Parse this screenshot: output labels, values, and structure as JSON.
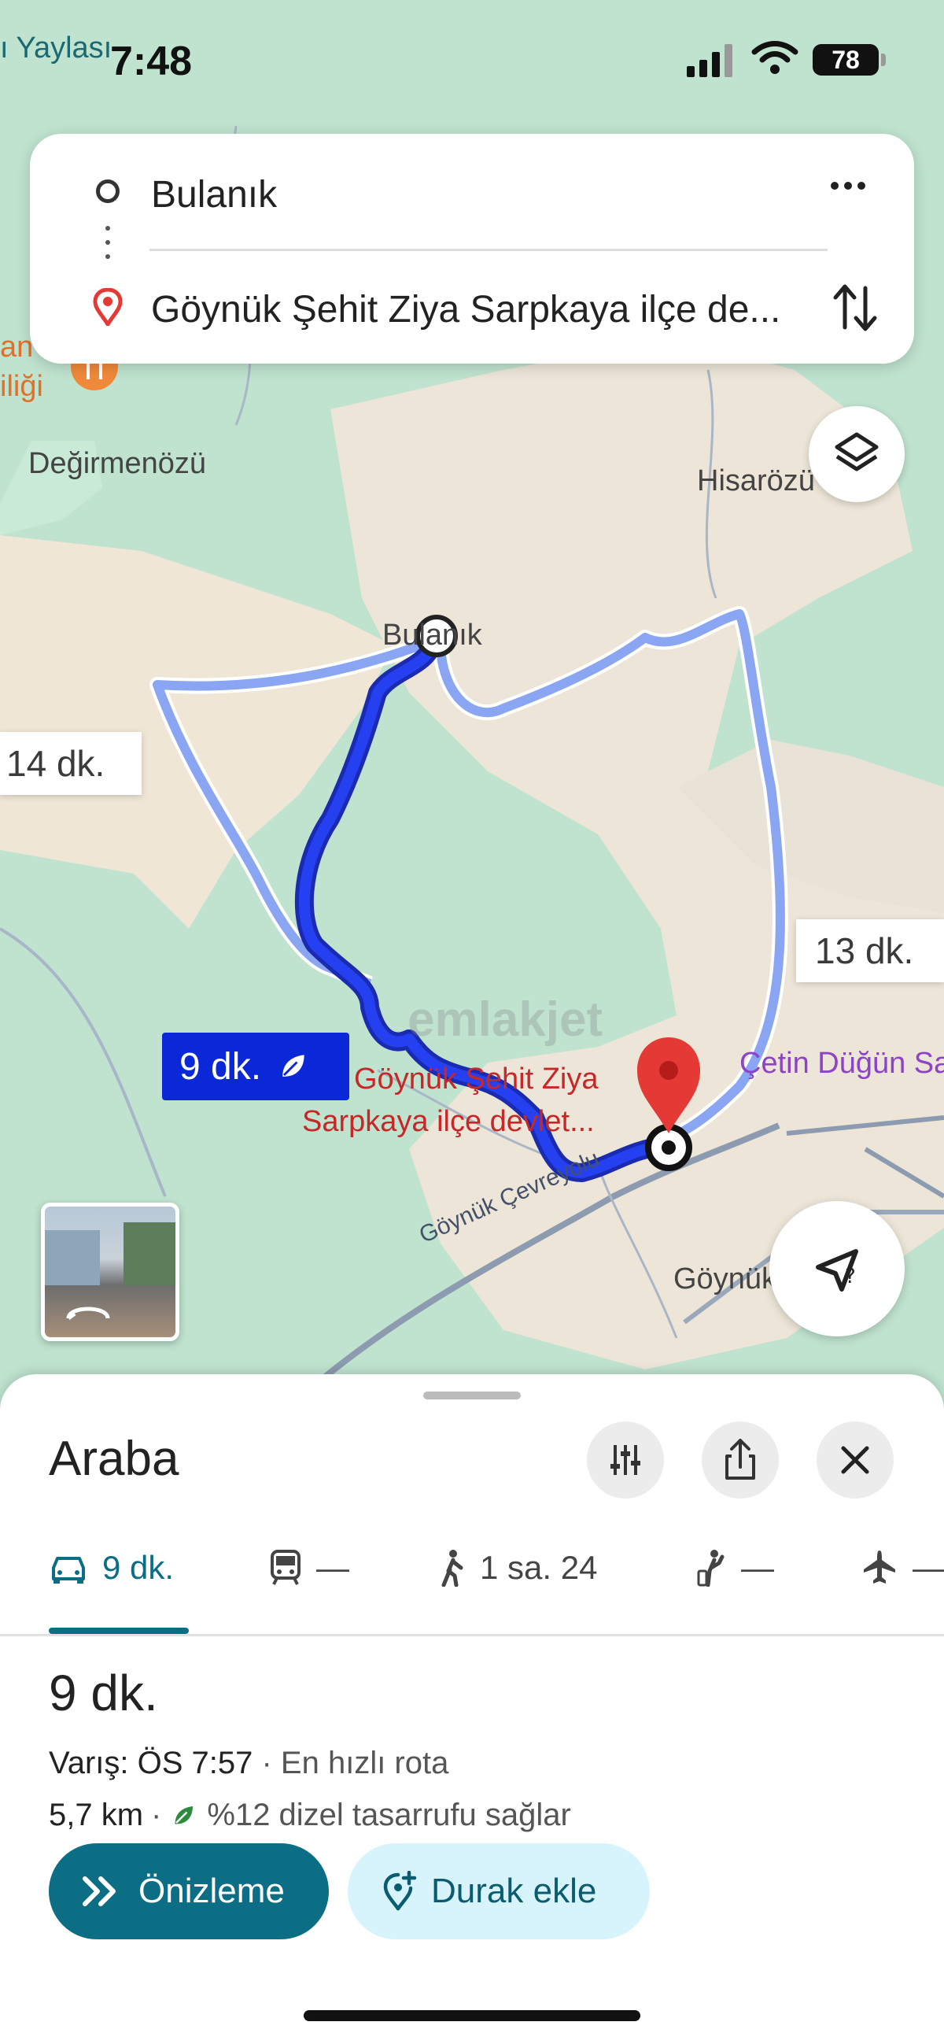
{
  "status_bar": {
    "time": "7:48",
    "battery": "78",
    "map_edge_label": "ı Yaylası"
  },
  "search": {
    "origin": "Bulanık",
    "destination": "Göynük Şehit Ziya Sarpkaya ilçe de..."
  },
  "map": {
    "places": {
      "degirmenozu": "Değirmenözü",
      "hisarozu": "Hisarözü",
      "bulanik": "Bulanık",
      "goynuk": "Göynük",
      "cetin": "Çetin Düğün Sa",
      "cevreyolu": "Göynük Çevreyolu",
      "left_fragment_1": "an",
      "left_fragment_2": "iliği"
    },
    "destination_label_line1": "Göynük Şehit Ziya",
    "destination_label_line2": "Sarpkaya ilçe devlet...",
    "watermark": "emlakjet",
    "route_bubbles": {
      "main": "9 dk.",
      "alt_left": "14 dk.",
      "alt_right": "13 dk."
    },
    "colors": {
      "main_route": "#0a28d8",
      "alt_route": "#8aa6f2",
      "destination_pin": "#e53935"
    }
  },
  "sheet": {
    "title": "Araba",
    "modes": [
      {
        "icon": "car-icon",
        "label": "9 dk."
      },
      {
        "icon": "transit-icon",
        "label": "—"
      },
      {
        "icon": "walk-icon",
        "label": "1 sa. 24"
      },
      {
        "icon": "ride-icon",
        "label": "—"
      },
      {
        "icon": "flight-icon",
        "label": "—"
      }
    ],
    "duration": "9 dk.",
    "arrival_label": "Varış: ÖS 7:57",
    "arrival_note": " · En hızlı rota",
    "distance": "5,7 km",
    "eco_note": "%12 dizel tasarrufu sağlar",
    "preview_button": "Önizleme",
    "add_stop_button": "Durak ekle",
    "accent_color": "#0b6e84"
  }
}
